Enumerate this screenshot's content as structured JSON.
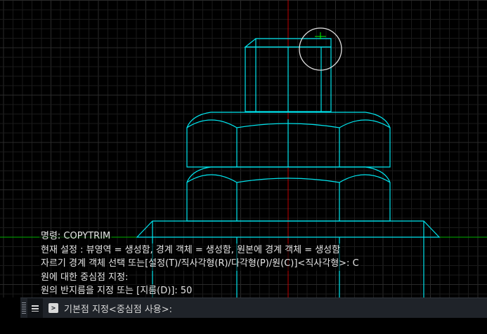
{
  "command_history": [
    "명령: COPYTRIM",
    "현재 설정 : 뷰영역 = 생성함, 경계 객체 = 생성함, 원본에 경계 객체 = 생성함",
    "자르기 경계 객체 선택 또는[설정(T)/직사각형(R)/다각형(P)/원(C)]<직사각형>: C",
    "원에 대한 중심점 지정:",
    "원의 반지름을 지정 또는 [지름(D)]: 50"
  ],
  "command_line": {
    "current_prompt": "기본점 지정<중심점 사용>:",
    "menu_icon": "hamburger-menu-icon",
    "prompt_icon": "terminal-prompt-icon"
  },
  "colors": {
    "background": "#000000",
    "grid_minor": "#1a1a1a",
    "grid_major": "#2a2a2a",
    "geometry": "#00e5ee",
    "x_axis": "#00b000",
    "y_axis": "#c00000",
    "cursor_circle": "#e0e0e0",
    "cursor_crosshair": "#00ff00"
  }
}
